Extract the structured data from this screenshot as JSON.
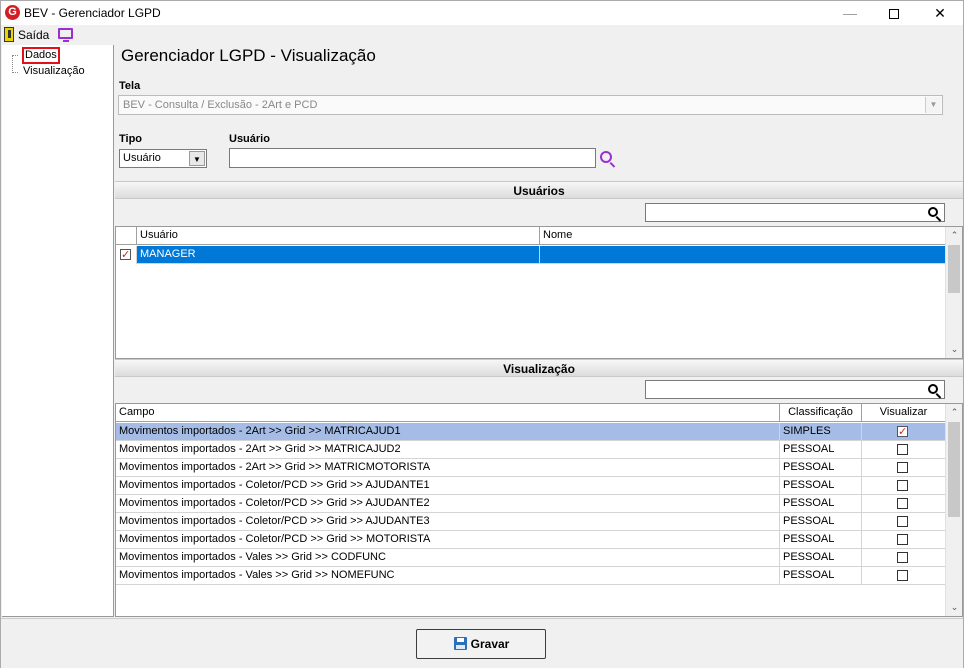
{
  "window": {
    "title": "BEV - Gerenciador LGPD",
    "logo_letter": "G"
  },
  "menu": {
    "saida_label": "Saída"
  },
  "tree": {
    "items": [
      "Dados",
      "Visualização"
    ]
  },
  "main": {
    "title": "Gerenciador LGPD - Visualização",
    "tela_label": "Tela",
    "tela_value": "BEV - Consulta / Exclusão - 2Art e PCD",
    "tipo_label": "Tipo",
    "tipo_value": "Usuário",
    "usuario_label": "Usuário",
    "usuario_value": ""
  },
  "usuarios_section": {
    "title": "Usuários",
    "filter_value": "",
    "columns": [
      "Usuário",
      "Nome"
    ],
    "rows": [
      {
        "checked": true,
        "usuario": "MANAGER",
        "nome": ""
      }
    ]
  },
  "visualizacao_section": {
    "title": "Visualização",
    "filter_value": "",
    "columns": [
      "Campo",
      "Classificação",
      "Visualizar"
    ],
    "rows": [
      {
        "campo": "Movimentos importados - 2Art >> Grid >> MATRICAJUD1",
        "classificacao": "SIMPLES",
        "visualizar": true
      },
      {
        "campo": "Movimentos importados - 2Art >> Grid >> MATRICAJUD2",
        "classificacao": "PESSOAL",
        "visualizar": false
      },
      {
        "campo": "Movimentos importados - 2Art >> Grid >> MATRICMOTORISTA",
        "classificacao": "PESSOAL",
        "visualizar": false
      },
      {
        "campo": "Movimentos importados - Coletor/PCD >> Grid >> AJUDANTE1",
        "classificacao": "PESSOAL",
        "visualizar": false
      },
      {
        "campo": "Movimentos importados - Coletor/PCD >> Grid >> AJUDANTE2",
        "classificacao": "PESSOAL",
        "visualizar": false
      },
      {
        "campo": "Movimentos importados - Coletor/PCD >> Grid >> AJUDANTE3",
        "classificacao": "PESSOAL",
        "visualizar": false
      },
      {
        "campo": "Movimentos importados - Coletor/PCD >> Grid >> MOTORISTA",
        "classificacao": "PESSOAL",
        "visualizar": false
      },
      {
        "campo": "Movimentos importados - Vales >> Grid >> CODFUNC",
        "classificacao": "PESSOAL",
        "visualizar": false
      },
      {
        "campo": "Movimentos importados - Vales >> Grid >> NOMEFUNC",
        "classificacao": "PESSOAL",
        "visualizar": false
      }
    ]
  },
  "footer": {
    "gravar_label": "Gravar"
  },
  "colors": {
    "accent_red": "#d21f26",
    "selection_blue": "#0078d7",
    "selection_light": "#a5bde6",
    "purple_icon": "#9b2fd4"
  }
}
